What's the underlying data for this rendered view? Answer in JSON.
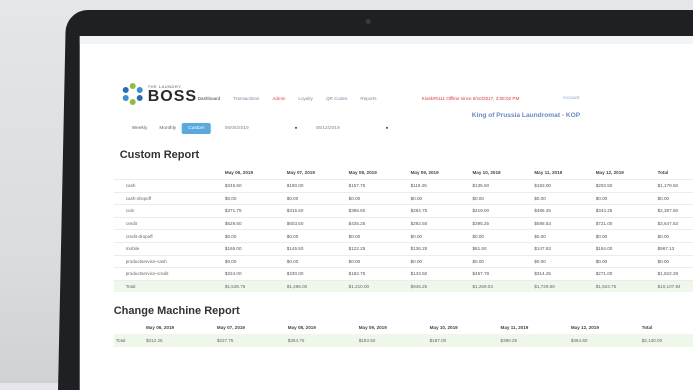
{
  "brand": {
    "small": "THE LAUNDRY",
    "big": "BOSS"
  },
  "nav": [
    {
      "label": "Dashboard",
      "style": "active"
    },
    {
      "label": "Transactions",
      "style": ""
    },
    {
      "label": "Admin",
      "style": "red"
    },
    {
      "label": "Loyalty",
      "style": ""
    },
    {
      "label": "QR Codes",
      "style": ""
    },
    {
      "label": "Reports",
      "style": ""
    }
  ],
  "status": {
    "offline": "Kiosk#0111 Offline since 8/10/2017, 3:08:02 PM",
    "account": "Account"
  },
  "location": "King of Prussia Laundromat - KOP",
  "filters": {
    "weekly": "Weekly",
    "monthly": "Monthly",
    "custom": "Custom",
    "start": "05/06/2019",
    "end": "05/12/2019"
  },
  "custom_report": {
    "title": "Custom Report",
    "columns": [
      "",
      "May 06, 2019",
      "May 07, 2019",
      "May 08, 2019",
      "May 09, 2019",
      "May 10, 2019",
      "May 11, 2019",
      "May 12, 2019",
      "Total"
    ],
    "rows": [
      [
        "cash",
        "$245.50",
        "$180.00",
        "$157.75",
        "$119.25",
        "$135.50",
        "$183.00",
        "$203.50",
        "$1,179.50"
      ],
      [
        "cash-dropoff",
        "$0.00",
        "$0.00",
        "$0.00",
        "$0.00",
        "$0.00",
        "$0.00",
        "$0.00",
        "$0.00"
      ],
      [
        "coin",
        "$371.75",
        "$315.50",
        "$366.50",
        "$284.75",
        "$219.00",
        "$486.25",
        "$344.25",
        "$2,387.50"
      ],
      [
        "credit",
        "$529.50",
        "$603.50",
        "$435.25",
        "$292.50",
        "$395.25",
        "$588.53",
        "$721.00",
        "$3,647.53"
      ],
      [
        "credit-dropoff",
        "$0.00",
        "$0.00",
        "$0.00",
        "$0.00",
        "$0.00",
        "$0.00",
        "$0.00",
        "$0.00"
      ],
      [
        "mobile",
        "$166.00",
        "$145.50",
        "$122.25",
        "$136.25",
        "$61.50",
        "$147.63",
        "$184.00",
        "$967.13"
      ],
      [
        "productservice-cash",
        "$0.00",
        "$0.00",
        "$0.00",
        "$0.00",
        "$0.00",
        "$0.00",
        "$0.00",
        "$0.00"
      ],
      [
        "productservice-credit",
        "$224.00",
        "$230.00",
        "$182.75",
        "$143.50",
        "$457.78",
        "$314.25",
        "$271.00",
        "$1,822.28"
      ]
    ],
    "total": [
      "Total",
      "$1,536.75",
      "$1,466.00",
      "$1,210.00",
      "$945.25",
      "$1,269.03",
      "$1,729.66",
      "$1,923.75",
      "$10,107.94"
    ]
  },
  "change_report": {
    "title": "Change Machine Report",
    "columns": [
      "",
      "May 06, 2019",
      "May 07, 2019",
      "May 08, 2019",
      "May 09, 2019",
      "May 10, 2019",
      "May 11, 2019",
      "May 12, 2019",
      "Total"
    ],
    "total": [
      "Total",
      "$312.25",
      "$227.75",
      "$354.75",
      "$193.50",
      "$187.00",
      "$390.25",
      "$464.50",
      "$2,130.00"
    ]
  },
  "colors": {
    "accent": "#5aa9de",
    "alert": "#d63b3b",
    "total_row": "#eef7ea"
  }
}
